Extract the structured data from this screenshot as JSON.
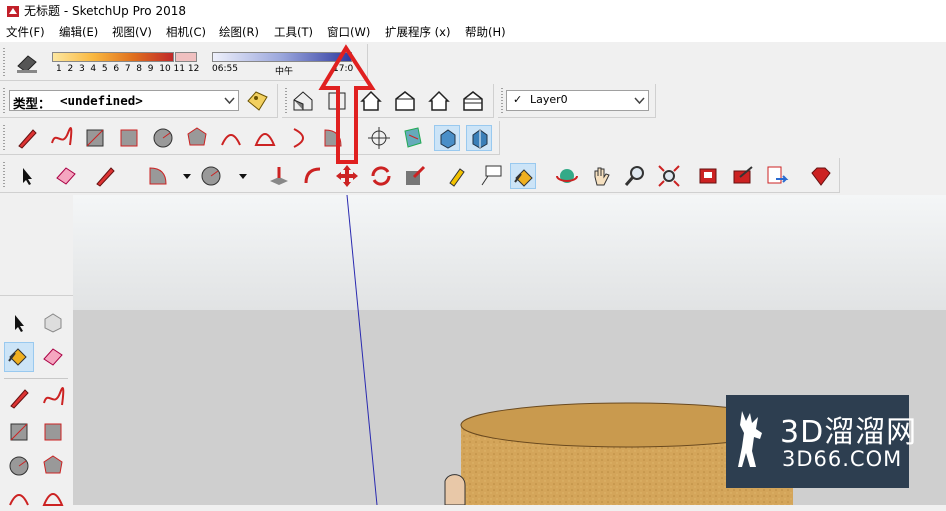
{
  "window": {
    "title": "无标题 - SketchUp Pro 2018"
  },
  "menubar": {
    "items": [
      "文件(F)",
      "编辑(E)",
      "视图(V)",
      "相机(C)",
      "绘图(R)",
      "工具(T)",
      "窗口(W)",
      "扩展程序 (x)",
      "帮助(H)"
    ]
  },
  "shadow_toolbar": {
    "month_ticks": [
      "1",
      "2",
      "3",
      "4",
      "5",
      "6",
      "7",
      "8",
      "9",
      "10",
      "11",
      "12"
    ],
    "time_start": "06:55",
    "time_mid": "中午",
    "time_end": "17:0"
  },
  "type_selector": {
    "label": "类型：",
    "value": "<undefined>"
  },
  "layer_selector": {
    "check": "✓",
    "value": "Layer0"
  },
  "colors": {
    "annotation_arrow": "#e02020",
    "accent_selected": "#cce4f7",
    "wood_texture": "#d4a55a",
    "watermark_bg": "#2d3e50"
  },
  "watermark": {
    "brand": "3D溜溜网",
    "url": "3D66.COM"
  }
}
